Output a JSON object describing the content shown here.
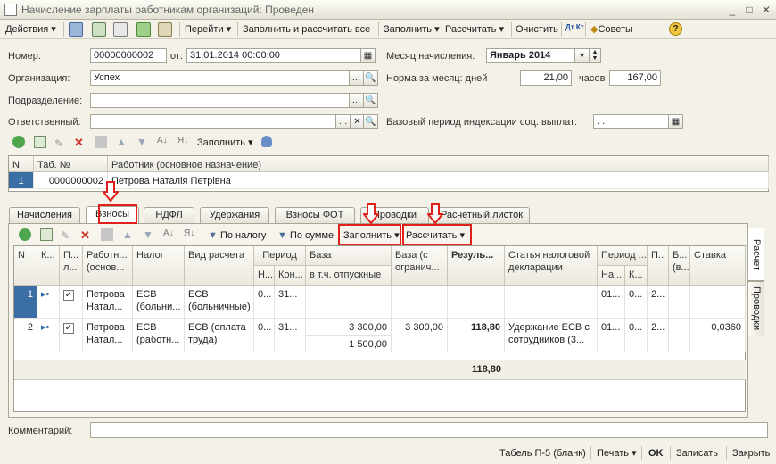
{
  "window": {
    "title": "Начисление зарплаты работникам организаций: Проведен"
  },
  "toolbar": {
    "actions": "Действия",
    "goto": "Перейти",
    "fill_and_calc": "Заполнить и рассчитать все",
    "fill": "Заполнить",
    "calc": "Рассчитать",
    "clear": "Очистить",
    "dt_kt": "Дт Кт",
    "tips": "Советы"
  },
  "form": {
    "number_label": "Номер:",
    "number_value": "00000000002",
    "date_label": "от:",
    "date_value": "31.01.2014 00:00:00",
    "month_label": "Месяц начисления:",
    "month_value": "Январь 2014",
    "org_label": "Организация:",
    "org_value": "Успех",
    "norm_label": "Норма за месяц: дней",
    "norm_days": "21,00",
    "hours_label": "часов",
    "norm_hours": "167,00",
    "dept_label": "Подразделение:",
    "dept_value": "",
    "resp_label": "Ответственный:",
    "resp_value": "",
    "base_label": "Базовый период индексации соц. выплат:",
    "base_value": ". ."
  },
  "emp_toolbar": {
    "fill": "Заполнить"
  },
  "emp_table": {
    "headers": [
      "N",
      "Таб. №",
      "Работник (основное назначение)"
    ],
    "rows": [
      [
        "1",
        "0000000002",
        "Петрова Наталія Петрівна"
      ]
    ]
  },
  "tabs": [
    "Начисления",
    "Взносы",
    "НДФЛ",
    "Удержания",
    "Взносы ФОТ",
    "Проводки",
    "Расчетный листок"
  ],
  "side_tabs": [
    "Расчет",
    "Проводки"
  ],
  "inner_toolbar": {
    "by_tax": "По налогу",
    "by_sum": "По сумме",
    "fill": "Заполнить",
    "calc": "Рассчитать"
  },
  "main_table": {
    "h_n": "N",
    "h_k": "К...",
    "h_p": "П... л...",
    "h_worker": "Работн... (основ...",
    "h_tax": "Налог",
    "h_calc": "Вид расчета",
    "h_period": "Период",
    "h_period_n": "Н...",
    "h_period_end": "Кон...",
    "h_base": "База",
    "h_base_sub": "в т.ч. отпускные",
    "h_base_lim": "База (с огранич...",
    "h_result": "Резуль...",
    "h_article": "Статья налоговой декларации",
    "h_period2": "Период ...",
    "h_period2_n": "На...",
    "h_period2_k": "К...",
    "h_p2": "П...",
    "h_b": "Б... (в...",
    "h_rate": "Ставка",
    "rows": [
      {
        "n": "1",
        "worker": "Петрова Натал...",
        "tax": "ЕСВ (больни...",
        "calc": "ЕСВ (больничные)",
        "pn": "0...",
        "pend": "31...",
        "base": "",
        "base_vac": "",
        "base_lim": "",
        "result": "",
        "article": "",
        "p2n": "01...",
        "p2k": "0...",
        "p2": "2...",
        "rate": ""
      },
      {
        "n": "2",
        "worker": "Петрова Натал...",
        "tax": "ЕСВ (работн...",
        "calc": "ЕСВ (оплата труда)",
        "pn": "0...",
        "pend": "31...",
        "base": "3 300,00",
        "base_vac": "1 500,00",
        "base_lim": "3 300,00",
        "result": "118,80",
        "article": "Удержание ЕСВ с сотрудников (3...",
        "p2n": "01...",
        "p2k": "0...",
        "p2": "2...",
        "rate": "0,0360"
      }
    ],
    "total_result": "118,80"
  },
  "comment": {
    "label": "Комментарий:",
    "value": ""
  },
  "bottom": {
    "t5": "Табель П-5 (бланк)",
    "print": "Печать",
    "ok": "OK",
    "save": "Записать",
    "close": "Закрыть"
  }
}
